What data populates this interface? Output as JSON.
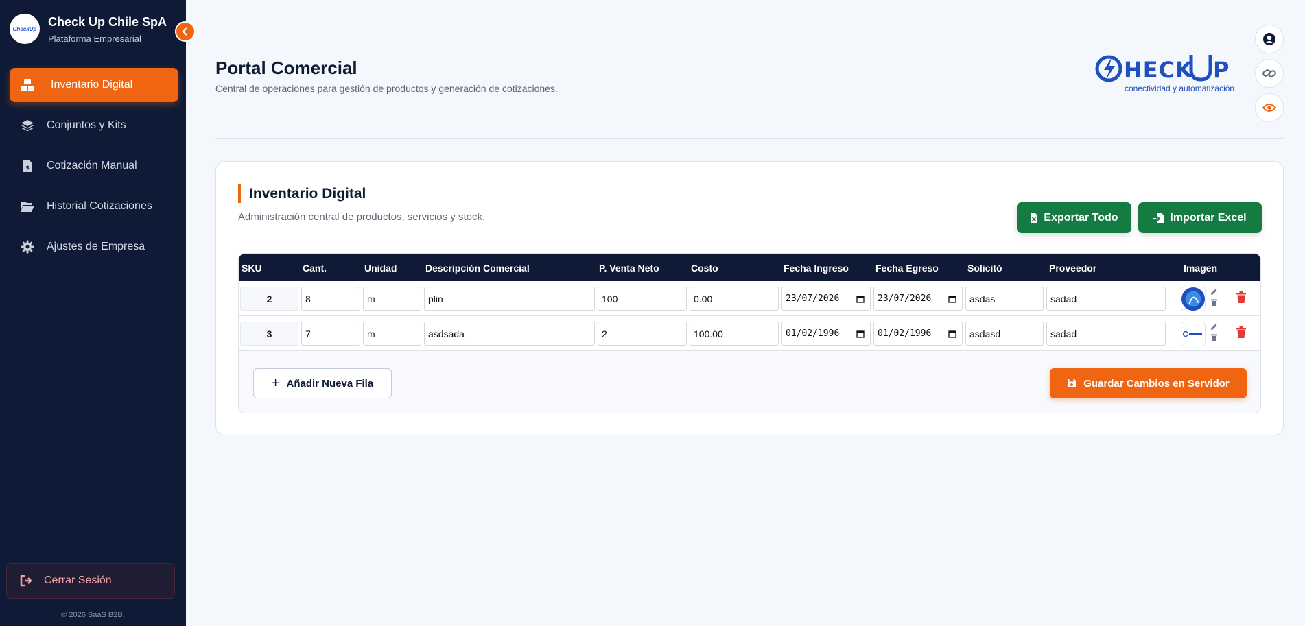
{
  "sidebar": {
    "brand_name": "Check Up Chile SpA",
    "brand_sub": "Plataforma Empresarial",
    "logo_text": "CheckUp",
    "items": [
      {
        "label": "Inventario Digital",
        "icon": "boxes-icon",
        "active": true
      },
      {
        "label": "Conjuntos y Kits",
        "icon": "layers-icon"
      },
      {
        "label": "Cotización Manual",
        "icon": "invoice-icon"
      },
      {
        "label": "Historial Cotizaciones",
        "icon": "folder-open-icon"
      },
      {
        "label": "Ajustes de Empresa",
        "icon": "gear-icon"
      }
    ],
    "logout_label": "Cerrar Sesión",
    "copyright": "© 2026 SaaS B2B."
  },
  "header": {
    "title": "Portal Comercial",
    "subtitle": "Central de operaciones para gestión de productos y generación de cotizaciones.",
    "logo_caption": "conectividad y automatización"
  },
  "card": {
    "title": "Inventario Digital",
    "subtitle": "Administración central de productos, servicios y stock.",
    "export_label": "Exportar Todo",
    "import_label": "Importar Excel"
  },
  "table": {
    "columns": [
      "SKU",
      "Cant.",
      "Unidad",
      "Descripción Comercial",
      "P. Venta Neto",
      "Costo",
      "Fecha Ingreso",
      "Fecha Egreso",
      "Solicitó",
      "Proveedor",
      "Imagen"
    ],
    "rows": [
      {
        "sku": "2",
        "cant": "8",
        "unidad": "m",
        "descripcion": "plin",
        "venta": "100",
        "costo": "0.00",
        "ingreso": "23/07/2026",
        "egreso": "23/07/2026",
        "solicito": "asdas",
        "proveedor": "sadad"
      },
      {
        "sku": "3",
        "cant": "7",
        "unidad": "m",
        "descripcion": "asdsada",
        "venta": "2",
        "costo": "100.00",
        "ingreso": "01/02/1996",
        "egreso": "01/02/1996",
        "solicito": "asdasd",
        "proveedor": "sadad"
      }
    ]
  },
  "actions": {
    "add_row_label": "Añadir Nueva Fila",
    "save_label": "Guardar Cambios en Servidor"
  },
  "colors": {
    "sidebar_bg": "#0f1b36",
    "accent": "#f06511",
    "green": "#157b43",
    "brand_blue": "#1f4fc1",
    "danger": "#e53935"
  }
}
